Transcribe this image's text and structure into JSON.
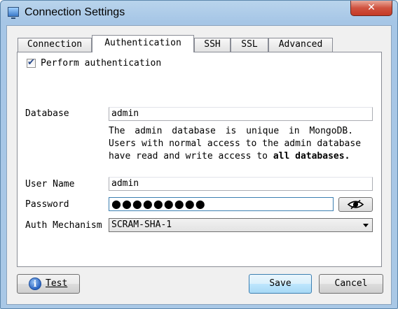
{
  "window": {
    "title": "Connection Settings",
    "close_glyph": "✕"
  },
  "tabs": [
    {
      "label": "Connection",
      "active": false
    },
    {
      "label": "Authentication",
      "active": true
    },
    {
      "label": "SSH",
      "active": false
    },
    {
      "label": "SSL",
      "active": false
    },
    {
      "label": "Advanced",
      "active": false
    }
  ],
  "auth": {
    "perform_checkbox": {
      "label": "Perform authentication",
      "checked": true,
      "glyph": "✔"
    },
    "database": {
      "label": "Database",
      "value": "admin"
    },
    "help": {
      "line1": "The admin database is unique in MongoDB.",
      "line2": "Users with normal access to the admin database",
      "line3_prefix": "have read and write access to ",
      "line3_bold": "all databases",
      "line3_suffix": "."
    },
    "user_name": {
      "label": "User Name",
      "value": "admin"
    },
    "password": {
      "label": "Password",
      "masked_value": "●●●●●●●●●",
      "toggle_icon": "eye-slash-icon"
    },
    "auth_mechanism": {
      "label": "Auth Mechanism",
      "selected": "SCRAM-SHA-1"
    }
  },
  "buttons": {
    "test": {
      "label": "Test",
      "icon": "info-icon",
      "icon_glyph": "i"
    },
    "save": {
      "label": "Save"
    },
    "cancel": {
      "label": "Cancel"
    }
  },
  "colors": {
    "title_bar": "#a9c8e6",
    "close_button": "#c43a26",
    "focus_border": "#3c7fb1"
  }
}
